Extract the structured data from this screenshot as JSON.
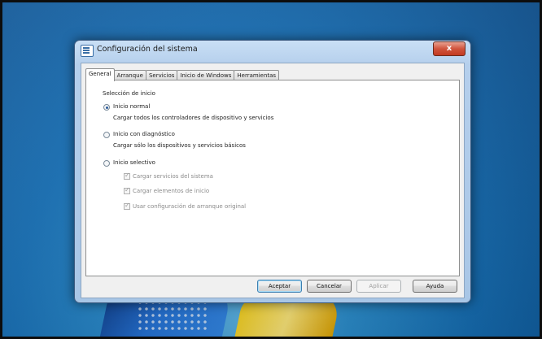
{
  "window": {
    "title": "Configuración del sistema",
    "close_glyph": "x"
  },
  "tabs": [
    {
      "label": "General",
      "active": true
    },
    {
      "label": "Arranque",
      "active": false
    },
    {
      "label": "Servicios",
      "active": false
    },
    {
      "label": "Inicio de Windows",
      "active": false
    },
    {
      "label": "Herramientas",
      "active": false
    }
  ],
  "general": {
    "group_label": "Selección de inicio",
    "options": [
      {
        "label": "Inicio normal",
        "description": "Cargar todos los controladores de dispositivo y servicios",
        "checked": true
      },
      {
        "label": "Inicio con diagnóstico",
        "description": "Cargar sólo los dispositivos y servicios básicos",
        "checked": false
      },
      {
        "label": "Inicio selectivo",
        "checked": false
      }
    ],
    "selective_checkboxes": [
      {
        "label": "Cargar servicios del sistema",
        "checked": true,
        "enabled": false
      },
      {
        "label": "Cargar elementos de inicio",
        "checked": true,
        "enabled": false
      },
      {
        "label": "Usar configuración de arranque original",
        "checked": true,
        "enabled": false
      }
    ]
  },
  "buttons": {
    "ok": "Aceptar",
    "cancel": "Cancelar",
    "apply": "Aplicar",
    "help": "Ayuda"
  },
  "colors": {
    "desktop_blue": "#1570b8",
    "dialog_frame": "#b5cfec",
    "close_red": "#c23a21"
  }
}
